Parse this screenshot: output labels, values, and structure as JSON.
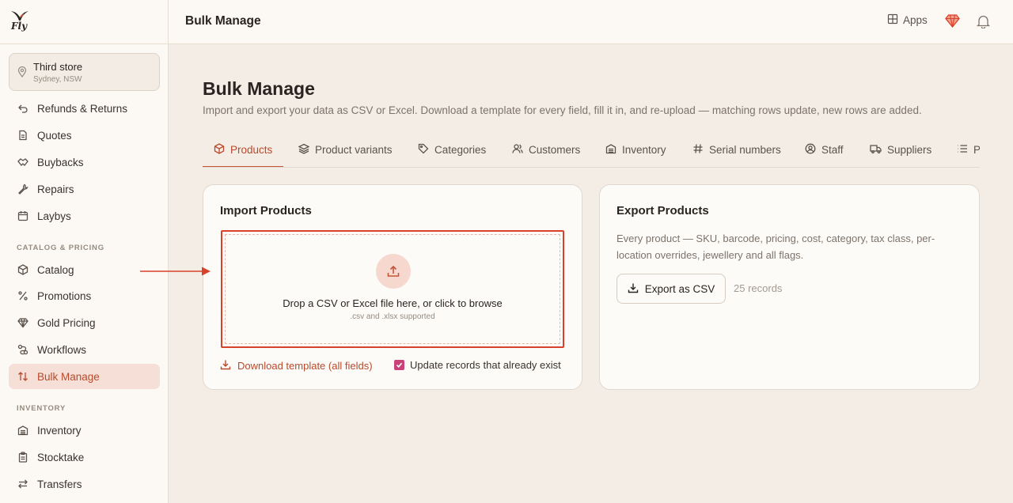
{
  "app": {
    "logo_text": "Fly"
  },
  "store": {
    "name": "Third store",
    "location": "Sydney, NSW"
  },
  "sidebar": {
    "items_top": [
      {
        "label": "Refunds & Returns",
        "icon": "undo-icon"
      },
      {
        "label": "Quotes",
        "icon": "document-icon"
      },
      {
        "label": "Buybacks",
        "icon": "handshake-icon"
      },
      {
        "label": "Repairs",
        "icon": "wrench-icon"
      },
      {
        "label": "Laybys",
        "icon": "calendar-icon"
      }
    ],
    "section_catalog": "CATALOG & PRICING",
    "items_catalog": [
      {
        "label": "Catalog",
        "icon": "box-icon"
      },
      {
        "label": "Promotions",
        "icon": "percent-icon"
      },
      {
        "label": "Gold Pricing",
        "icon": "gem-icon"
      },
      {
        "label": "Workflows",
        "icon": "workflow-icon"
      },
      {
        "label": "Bulk Manage",
        "icon": "sort-arrows-icon",
        "active": true
      }
    ],
    "section_inventory": "INVENTORY",
    "items_inventory": [
      {
        "label": "Inventory",
        "icon": "warehouse-icon"
      },
      {
        "label": "Stocktake",
        "icon": "clipboard-icon"
      },
      {
        "label": "Transfers",
        "icon": "transfer-icon"
      }
    ]
  },
  "topbar": {
    "title": "Bulk Manage",
    "apps_label": "Apps"
  },
  "page": {
    "title": "Bulk Manage",
    "description": "Import and export your data as CSV or Excel. Download a template for every field, fill it in, and re-upload — matching rows update, new rows are added."
  },
  "tabs": [
    {
      "label": "Products",
      "icon": "box-icon",
      "active": true
    },
    {
      "label": "Product variants",
      "icon": "layers-icon"
    },
    {
      "label": "Categories",
      "icon": "tag-icon"
    },
    {
      "label": "Customers",
      "icon": "users-icon"
    },
    {
      "label": "Inventory",
      "icon": "warehouse-icon"
    },
    {
      "label": "Serial numbers",
      "icon": "hash-icon"
    },
    {
      "label": "Staff",
      "icon": "user-circle-icon"
    },
    {
      "label": "Suppliers",
      "icon": "truck-icon"
    },
    {
      "label": "P",
      "icon": "list-icon"
    }
  ],
  "import": {
    "title": "Import Products",
    "drop_text": "Drop a CSV or Excel file here, or click to browse",
    "drop_sub": ".csv and .xlsx supported",
    "download_label": "Download template (all fields)",
    "update_label": "Update records that already exist",
    "update_checked": true
  },
  "export": {
    "title": "Export Products",
    "description": "Every product — SKU, barcode, pricing, cost, category, tax class, per-location overrides, jewellery and all flags.",
    "button_label": "Export as CSV",
    "records": "25 records"
  },
  "colors": {
    "accent": "#b84a2c",
    "highlight": "#d8412a",
    "checkbox": "#c8437a"
  }
}
